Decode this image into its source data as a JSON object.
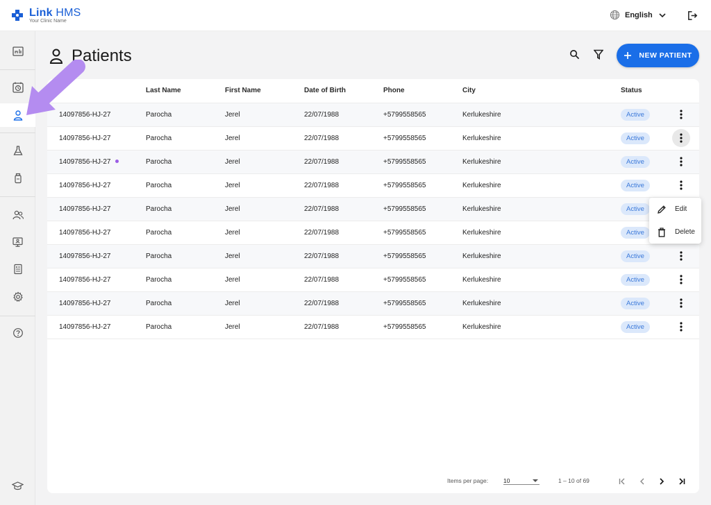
{
  "app": {
    "name_part1": "Link",
    "name_part2": "HMS",
    "subtitle": "Your Clinic Name",
    "brand_color": "#1a5fd6"
  },
  "header": {
    "language": "English",
    "language_icon": "globe-icon",
    "logout_icon": "logout-icon"
  },
  "sidebar": {
    "items": [
      {
        "name": "dashboard",
        "icon": "dashboard-icon"
      },
      {
        "name": "appointments",
        "icon": "calendar-clock-icon"
      },
      {
        "name": "patients",
        "icon": "user-icon",
        "active": true
      },
      {
        "name": "lab",
        "icon": "flask-icon"
      },
      {
        "name": "pharmacy",
        "icon": "bottle-icon"
      },
      {
        "name": "staff",
        "icon": "users-icon"
      },
      {
        "name": "monitor",
        "icon": "monitor-icon"
      },
      {
        "name": "reports",
        "icon": "report-icon"
      },
      {
        "name": "settings",
        "icon": "gear-icon"
      },
      {
        "name": "help",
        "icon": "help-icon"
      },
      {
        "name": "training",
        "icon": "graduation-cap-icon"
      }
    ],
    "active_color": "#1a6ee8"
  },
  "page": {
    "title": "Patients",
    "new_button_label": "NEW PATIENT",
    "accent_color": "#1a6ee8"
  },
  "table": {
    "columns": [
      "",
      "Last Name",
      "First Name",
      "Date of Birth",
      "Phone",
      "City",
      "Status",
      ""
    ],
    "rows": [
      {
        "id": "14097856-HJ-27",
        "last": "Parocha",
        "first": "Jerel",
        "dob": "22/07/1988",
        "phone": "+5799558565",
        "city": "Kerlukeshire",
        "status": "Active"
      },
      {
        "id": "14097856-HJ-27",
        "last": "Parocha",
        "first": "Jerel",
        "dob": "22/07/1988",
        "phone": "+5799558565",
        "city": "Kerlukeshire",
        "status": "Active"
      },
      {
        "id": "14097856-HJ-27",
        "last": "Parocha",
        "first": "Jerel",
        "dob": "22/07/1988",
        "phone": "+5799558565",
        "city": "Kerlukeshire",
        "status": "Active"
      },
      {
        "id": "14097856-HJ-27",
        "last": "Parocha",
        "first": "Jerel",
        "dob": "22/07/1988",
        "phone": "+5799558565",
        "city": "Kerlukeshire",
        "status": "Active"
      },
      {
        "id": "14097856-HJ-27",
        "last": "Parocha",
        "first": "Jerel",
        "dob": "22/07/1988",
        "phone": "+5799558565",
        "city": "Kerlukeshire",
        "status": "Active"
      },
      {
        "id": "14097856-HJ-27",
        "last": "Parocha",
        "first": "Jerel",
        "dob": "22/07/1988",
        "phone": "+5799558565",
        "city": "Kerlukeshire",
        "status": "Active"
      },
      {
        "id": "14097856-HJ-27",
        "last": "Parocha",
        "first": "Jerel",
        "dob": "22/07/1988",
        "phone": "+5799558565",
        "city": "Kerlukeshire",
        "status": "Active"
      },
      {
        "id": "14097856-HJ-27",
        "last": "Parocha",
        "first": "Jerel",
        "dob": "22/07/1988",
        "phone": "+5799558565",
        "city": "Kerlukeshire",
        "status": "Active"
      },
      {
        "id": "14097856-HJ-27",
        "last": "Parocha",
        "first": "Jerel",
        "dob": "22/07/1988",
        "phone": "+5799558565",
        "city": "Kerlukeshire",
        "status": "Active"
      },
      {
        "id": "14097856-HJ-27",
        "last": "Parocha",
        "first": "Jerel",
        "dob": "22/07/1988",
        "phone": "+5799558565",
        "city": "Kerlukeshire",
        "status": "Active"
      }
    ],
    "row_with_dot_index": 2,
    "open_menu_row_index": 1,
    "status_badge_color": "#dbe8fb",
    "status_text_color": "#3b79d9"
  },
  "row_menu": {
    "items": [
      {
        "label": "Edit",
        "icon": "pencil-icon"
      },
      {
        "label": "Delete",
        "icon": "trash-icon"
      }
    ]
  },
  "pagination": {
    "items_per_page_label": "Items per page:",
    "items_per_page_value": "10",
    "range_text": "1 – 10 of 69"
  },
  "overlay": {
    "arrow_icon": "pointer-arrow-icon",
    "arrow_color": "#b48cf0"
  }
}
